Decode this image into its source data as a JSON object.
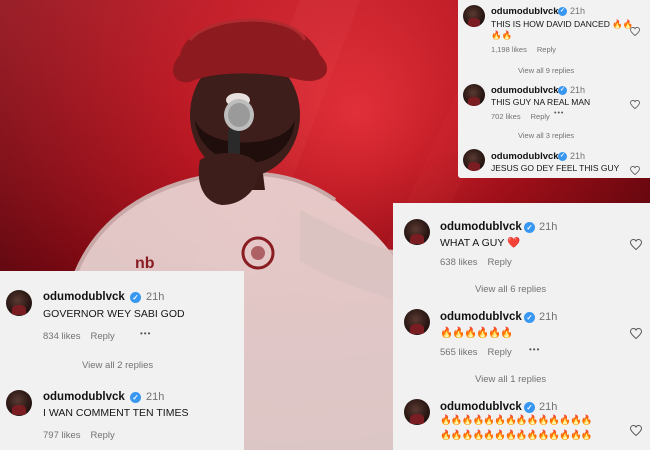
{
  "user": {
    "username": "odumodublvck",
    "verified_icon": "verified-badge-icon",
    "verified_color": "#3897f0"
  },
  "card_top_right": {
    "comments": [
      {
        "time": "21h",
        "text": "THIS IS HOW DAVID DANCED 🔥🔥",
        "text_line2": "🔥🔥",
        "likes": "1,198 likes",
        "reply": "Reply",
        "view_all": "View all 9 replies"
      },
      {
        "time": "21h",
        "text": "THIS GUY NA REAL MAN",
        "likes": "702 likes",
        "reply": "Reply",
        "more": "•••",
        "view_all": "View all 3 replies"
      },
      {
        "time": "21h",
        "text": "JESUS GO DEY FEEL THIS GUY"
      }
    ]
  },
  "card_right": {
    "comments": [
      {
        "time": "21h",
        "text": "WHAT A GUY ❤️",
        "likes": "638 likes",
        "reply": "Reply",
        "view_all": "View all 6 replies"
      },
      {
        "time": "21h",
        "text": "🔥🔥🔥🔥🔥🔥",
        "likes": "565 likes",
        "reply": "Reply",
        "more": "•••",
        "view_all": "View all 1 replies"
      },
      {
        "time": "21h",
        "text": "🔥🔥🔥🔥🔥🔥🔥🔥🔥🔥🔥🔥🔥🔥",
        "text_line2": "🔥🔥🔥🔥🔥🔥🔥🔥🔥🔥🔥🔥🔥🔥"
      }
    ]
  },
  "card_left": {
    "comments": [
      {
        "time": "21h",
        "text": "GOVERNOR WEY SABI GOD",
        "likes": "834 likes",
        "reply": "Reply",
        "more": "•••",
        "view_all": "View all 2 replies"
      },
      {
        "time": "21h",
        "text": "I WAN COMMENT TEN TIMES",
        "likes": "797 likes",
        "reply": "Reply"
      }
    ]
  },
  "colors": {
    "card_background": "#f2f2f3",
    "meta_text": "#737373",
    "stage_red": "#b3121d"
  },
  "icons": {
    "like": "heart-outline-icon",
    "avatar": "profile-avatar"
  }
}
